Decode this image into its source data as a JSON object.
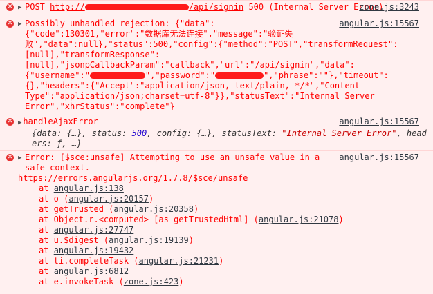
{
  "entries": {
    "post": {
      "method": "POST",
      "url_prefix": "http://",
      "url_suffix": "/api/signin",
      "status": "500 (Internal Server Error)",
      "source": "zone.js:3243"
    },
    "rejection": {
      "source": "angular.js:15567",
      "lines": [
        "Possibly unhandled rejection: {\"data\":",
        "{\"code\":130301,\"error\":\"数据库无法连接\",\"message\":\"验证失",
        "败\",\"data\":null},\"status\":500,\"config\":{\"method\":\"POST\",\"transformRequest\":",
        "[null],\"transformResponse\":",
        "[null],\"jsonpCallbackParam\":\"callback\",\"url\":\"/api/signin\",\"data\":"
      ],
      "cred_a": "{\"username\":\"",
      "cred_b": "\",\"password\":\"",
      "cred_c": "\",\"phrase\":\"\"},\"timeout\":",
      "tail_lines": [
        "{},\"headers\":{\"Accept\":\"application/json, text/plain, */*\",\"Content-",
        "Type\":\"application/json;charset=utf-8\"}},\"statusText\":\"Internal Server",
        "Error\",\"xhrStatus\":\"complete\"}"
      ]
    },
    "ajax": {
      "label": "handleAjaxError",
      "source": "angular.js:15567",
      "obj_a": "{data: {…}, status: ",
      "obj_status": "500",
      "obj_b": ", config: {…}, statusText: ",
      "obj_text": "\"Internal Server Error\"",
      "obj_c": ", head",
      "obj_d": "ers: ƒ, …}"
    },
    "sce": {
      "source": "angular.js:15567",
      "line1": "Error: [$sce:unsafe] Attempting to use an unsafe value in a",
      "line2": "safe context.",
      "doc_url": "https://errors.angularjs.org/1.7.8/$sce/unsafe",
      "stack": [
        {
          "prefix": "at ",
          "link": "angular.js:138",
          "plain": true
        },
        {
          "prefix": "at o (",
          "link": "angular.js:20157",
          "suffix": ")"
        },
        {
          "prefix": "at getTrusted (",
          "link": "angular.js:20358",
          "suffix": ")"
        },
        {
          "prefix": "at Object.r.<computed> [as getTrustedHtml] (",
          "link": "angular.js:21078",
          "suffix": ")"
        },
        {
          "prefix": "at ",
          "link": "angular.js:27747",
          "plain": true
        },
        {
          "prefix": "at u.$digest (",
          "link": "angular.js:19139",
          "suffix": ")"
        },
        {
          "prefix": "at ",
          "link": "angular.js:19432",
          "plain": true
        },
        {
          "prefix": "at ti.completeTask (",
          "link": "angular.js:21231",
          "suffix": ")"
        },
        {
          "prefix": "at ",
          "link": "angular.js:6812",
          "plain": true
        },
        {
          "prefix": "at e.invokeTask (",
          "link": "zone.js:423",
          "suffix": ")"
        }
      ]
    }
  },
  "colors": {
    "error_text": "#ff0000",
    "error_bg": "#fff0f0",
    "redaction": "#ff1a1a",
    "link": "#303942"
  },
  "icons": {
    "error": "error-circle-icon",
    "expand": "expand-triangle-icon"
  }
}
